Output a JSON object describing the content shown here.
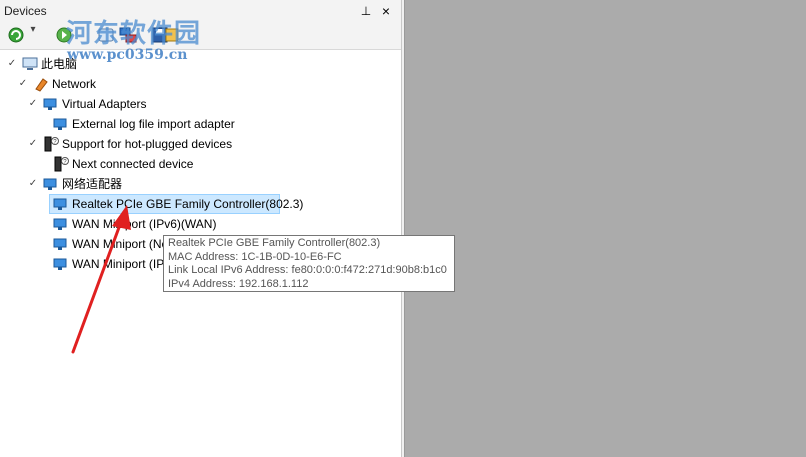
{
  "panel": {
    "title": "Devices",
    "pin_glyph": "⊥",
    "close_glyph": "×"
  },
  "toolbar": {
    "buttons": [
      "refresh-icon",
      "back-icon",
      "forward-icon",
      "network-icon",
      "save-icon",
      "add-icon"
    ]
  },
  "watermark": {
    "line1": "河东软件园",
    "line2": "www.pc0359.cn",
    "color": "#4a8bd0"
  },
  "tree": {
    "root": "此电脑",
    "network": "Network",
    "virtual_adapters": "Virtual Adapters",
    "external_log": "External log file import adapter",
    "hot_plug": "Support for hot-plugged devices",
    "next_device": "Next connected device",
    "adapters_group": "网络适配器",
    "realtek": "Realtek PCIe GBE Family Controller(802.3)",
    "wan_ipv6": "WAN Miniport (IPv6)(WAN)",
    "wan_net": "WAN Miniport (Net",
    "wan_ip": "WAN Miniport (IP)("
  },
  "tooltip": {
    "line1": "Realtek PCIe GBE Family Controller(802.3)",
    "line2": "MAC Address: 1C-1B-0D-10-E6-FC",
    "line3": "Link Local IPv6 Address: fe80:0:0:0:f472:271d:90b8:b1c0",
    "line4": "IPv4 Address: 192.168.1.112"
  },
  "colors": {
    "accent": "#cce8ff",
    "arrow": "#e02020",
    "background": "#ababab"
  }
}
